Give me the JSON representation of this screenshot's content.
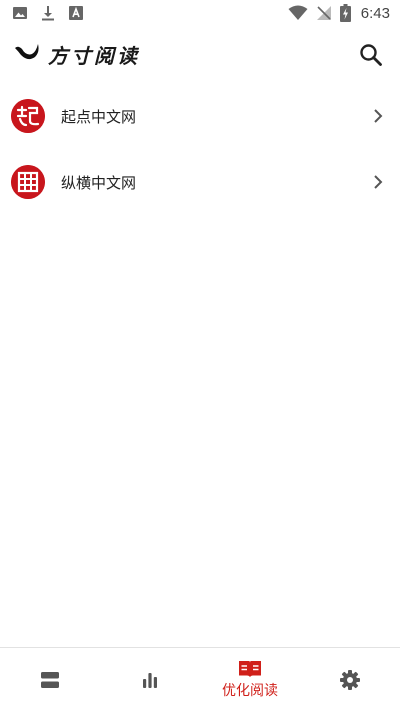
{
  "status_bar": {
    "time": "6:43",
    "left_icons": [
      "image-icon",
      "download-icon",
      "text-a-icon"
    ],
    "right_icons": [
      "wifi-icon",
      "signal-icon",
      "battery-charging-icon"
    ]
  },
  "header": {
    "title": "方寸阅读",
    "logo_icon": "brush-stroke-logo-icon",
    "search_icon": "search-icon"
  },
  "sources": [
    {
      "label": "起点中文网",
      "icon": "qidian-logo-icon"
    },
    {
      "label": "纵横中文网",
      "icon": "zongheng-logo-icon"
    }
  ],
  "bottom_nav": {
    "tabs": [
      {
        "label": "",
        "icon": "bookshelf-icon",
        "active": false
      },
      {
        "label": "",
        "icon": "bar-chart-icon",
        "active": false
      },
      {
        "label": "优化阅读",
        "icon": "open-book-icon",
        "active": true
      },
      {
        "label": "",
        "icon": "gear-icon",
        "active": false
      }
    ]
  },
  "colors": {
    "accent": "#d0201a",
    "icon_gray": "#555555",
    "status_gray": "#666666"
  }
}
